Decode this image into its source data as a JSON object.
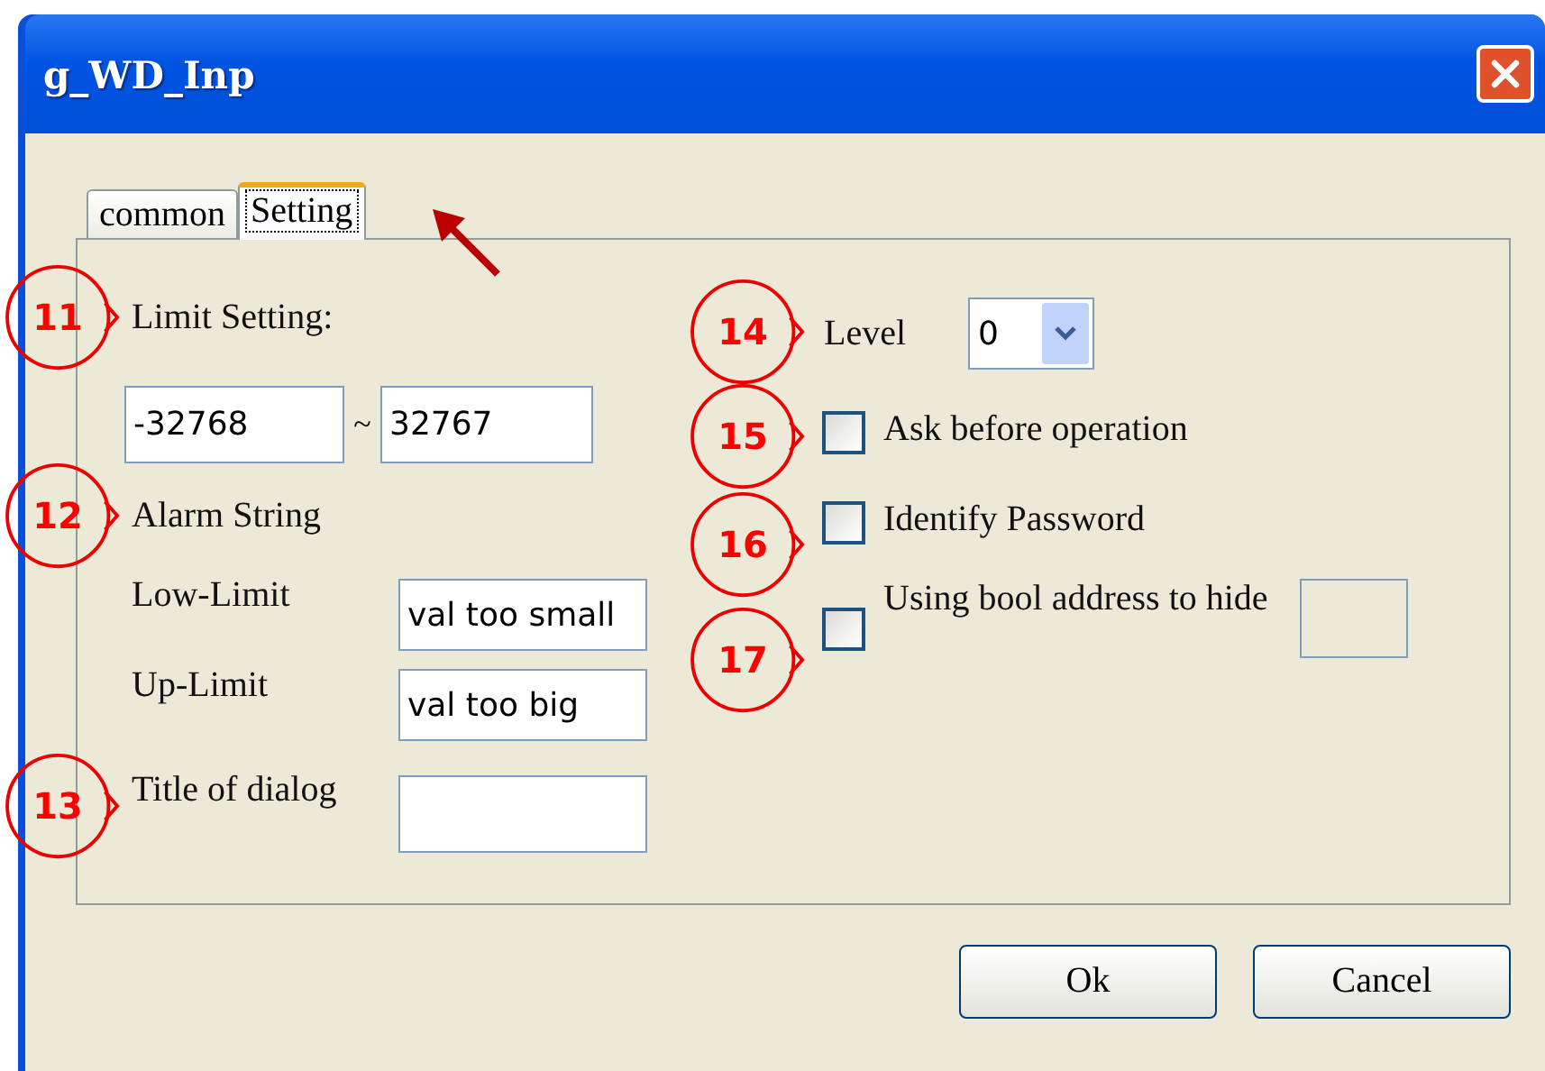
{
  "window": {
    "title": "g_WD_Inp"
  },
  "tabs": [
    {
      "label": "common",
      "selected": false
    },
    {
      "label": "Setting",
      "selected": true
    }
  ],
  "limit_setting": {
    "callout": "11",
    "label": "Limit Setting:",
    "min": "-32768",
    "separator": "~",
    "max": "32767"
  },
  "alarm_string": {
    "callout": "12",
    "label": "Alarm String",
    "fields": [
      {
        "label": "Low-Limit",
        "value": "val too small"
      },
      {
        "label": "Up-Limit",
        "value": "val too big"
      }
    ]
  },
  "title_of_dialog": {
    "callout": "13",
    "label": "Title of dialog"
  },
  "level": {
    "callout": "14",
    "label": "Level",
    "value": "0"
  },
  "options": [
    {
      "callout": "15",
      "label": "Ask before operation",
      "checked": false,
      "kind": "checkbox"
    },
    {
      "callout": "16",
      "label": "Identify Password",
      "checked": false,
      "kind": "checkbox"
    },
    {
      "callout": "17",
      "label": "Using bool address to hide",
      "checked": false,
      "kind": "checkbox-address"
    }
  ],
  "buttons": [
    "Ok",
    "Cancel"
  ]
}
